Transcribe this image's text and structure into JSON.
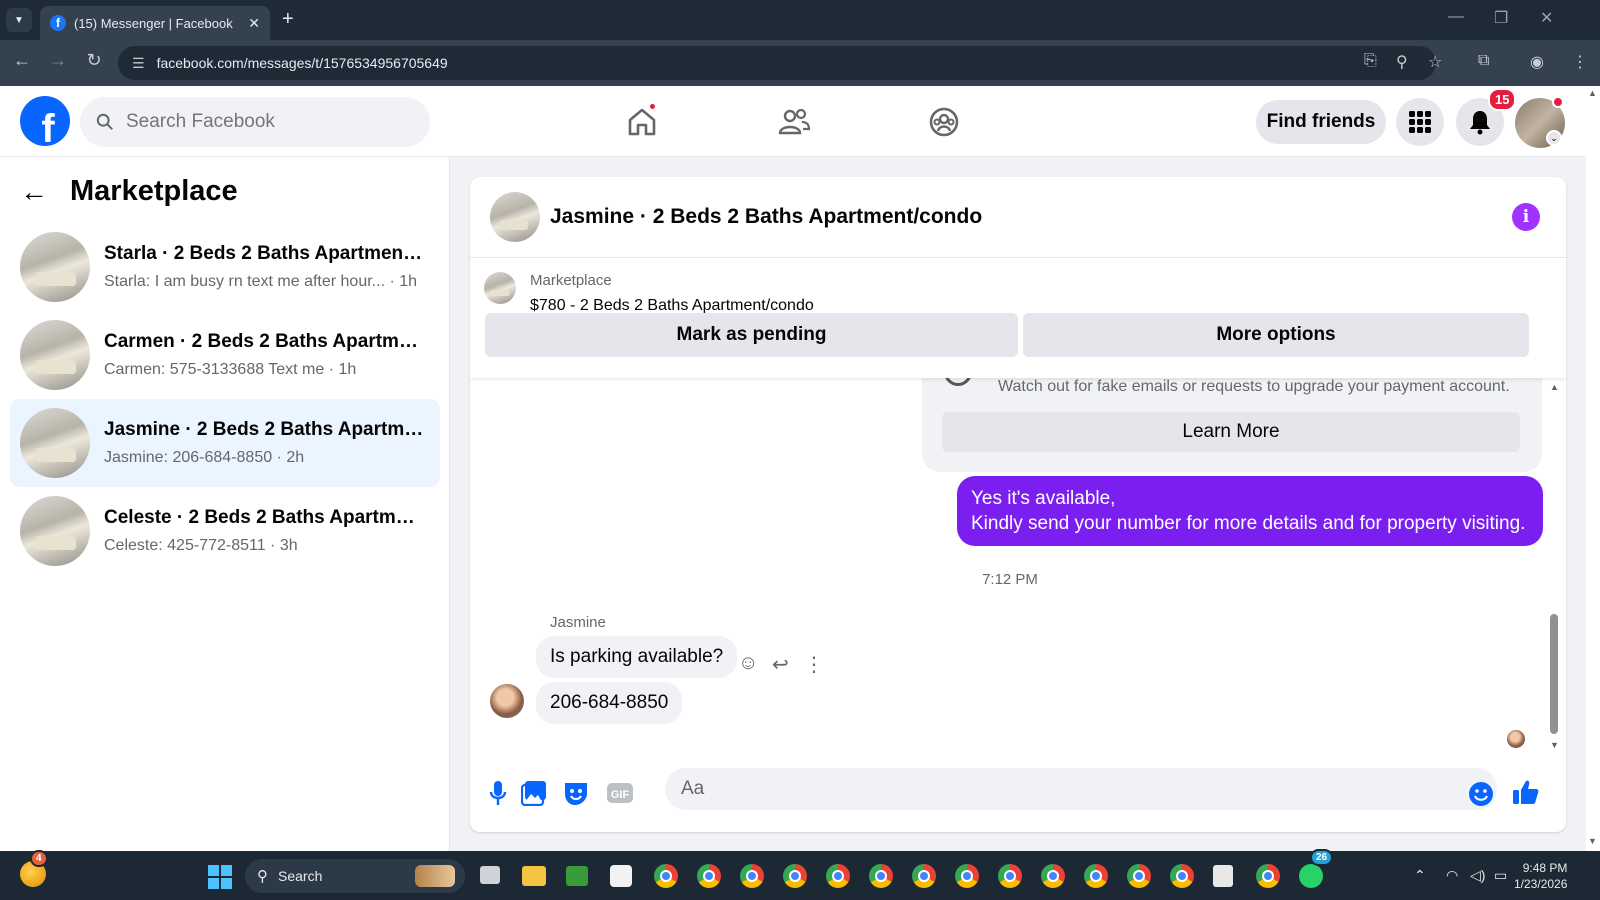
{
  "browser": {
    "tab_title": "(15) Messenger | Facebook",
    "url": "facebook.com/messages/t/1576534956705649"
  },
  "header": {
    "search_placeholder": "Search Facebook",
    "find_friends": "Find friends",
    "notifications_count": "15"
  },
  "sidebar": {
    "title": "Marketplace",
    "conversations": [
      {
        "name": "Starla · 2 Beds 2 Baths Apartment/...",
        "preview": "Starla: I am busy rn text me after hour... · 1h"
      },
      {
        "name": "Carmen · 2 Beds 2 Baths Apartme...",
        "preview": "Carmen: 575-3133688 Text me · 1h"
      },
      {
        "name": "Jasmine · 2 Beds 2 Baths Apartme...",
        "preview": "Jasmine: 206-684-8850 · 2h",
        "active": true
      },
      {
        "name": "Celeste · 2 Beds 2 Baths Apartmen...",
        "preview": "Celeste: 425-772-8511 · 3h"
      }
    ]
  },
  "chat": {
    "title": "Jasmine · 2 Beds 2 Baths Apartment/condo",
    "listing_source": "Marketplace",
    "listing_price": "$780 - 2 Beds 2 Baths Apartment/condo",
    "mark_pending": "Mark as pending",
    "more_options": "More options",
    "warning_text": "Watch out for fake emails or requests to upgrade your payment account.",
    "learn_more": "Learn More",
    "outgoing_line1": "Yes it's available,",
    "outgoing_line2": "Kindly send your number for more details and for property visiting.",
    "timestamp": "7:12 PM",
    "sender_name": "Jasmine",
    "incoming_1": "Is parking available?",
    "incoming_2": "206-684-8850",
    "composer_placeholder": "Aa"
  },
  "taskbar": {
    "search_label": "Search",
    "weather_badge": "4",
    "whatsapp_badge": "26",
    "time": "9:48 PM",
    "date": "1/23/2026"
  },
  "colors": {
    "fb_blue": "#0866ff",
    "messenger_purple": "#7b1ff0",
    "badge_red": "#e41e3f"
  }
}
